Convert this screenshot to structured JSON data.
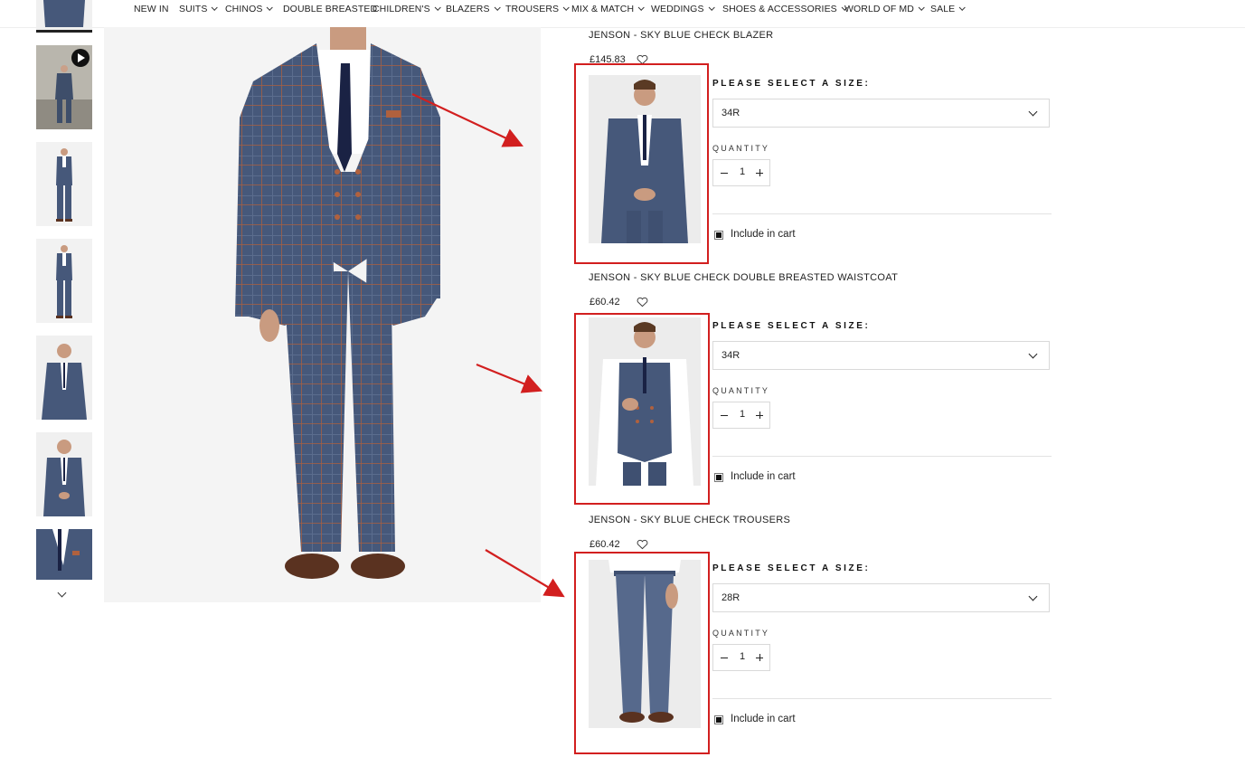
{
  "nav": {
    "items": [
      {
        "label": "NEW IN",
        "dropdown": false
      },
      {
        "label": "SUITS",
        "dropdown": true
      },
      {
        "label": "CHINOS",
        "dropdown": true
      },
      {
        "label": "DOUBLE BREASTED",
        "dropdown": false
      },
      {
        "label": "CHILDREN'S",
        "dropdown": true
      },
      {
        "label": "BLAZERS",
        "dropdown": true
      },
      {
        "label": "TROUSERS",
        "dropdown": true
      },
      {
        "label": "MIX & MATCH",
        "dropdown": true
      },
      {
        "label": "WEDDINGS",
        "dropdown": true
      },
      {
        "label": "SHOES & ACCESSORIES",
        "dropdown": true
      },
      {
        "label": "WORLD OF MD",
        "dropdown": true
      },
      {
        "label": "SALE",
        "dropdown": true
      }
    ]
  },
  "gallery": {
    "thumbnails": [
      {
        "kind": "partial"
      },
      {
        "kind": "video"
      },
      {
        "kind": "full-suit"
      },
      {
        "kind": "full-suit"
      },
      {
        "kind": "half-body"
      },
      {
        "kind": "half-body"
      },
      {
        "kind": "detail"
      }
    ]
  },
  "products": [
    {
      "name": "JENSON - SKY BLUE CHECK BLAZER",
      "price": "£145.83",
      "size_label": "PLEASE SELECT A SIZE:",
      "size_value": "34R",
      "quantity_label": "QUANTITY",
      "quantity": "1",
      "cart_label": "Include in cart",
      "included": true,
      "image": "blazer"
    },
    {
      "name": "JENSON - SKY BLUE CHECK DOUBLE BREASTED WAISTCOAT",
      "price": "£60.42",
      "size_label": "PLEASE SELECT A SIZE:",
      "size_value": "34R",
      "quantity_label": "QUANTITY",
      "quantity": "1",
      "cart_label": "Include in cart",
      "included": true,
      "image": "waistcoat"
    },
    {
      "name": "JENSON - SKY BLUE CHECK TROUSERS",
      "price": "£60.42",
      "size_label": "PLEASE SELECT A SIZE:",
      "size_value": "28R",
      "quantity_label": "QUANTITY",
      "quantity": "1",
      "cart_label": "Include in cart",
      "included": true,
      "image": "trousers"
    }
  ],
  "colors": {
    "suit": "#46587a",
    "check": "#b0613e",
    "annotation": "#d21f1f",
    "shoe": "#5a3220"
  }
}
